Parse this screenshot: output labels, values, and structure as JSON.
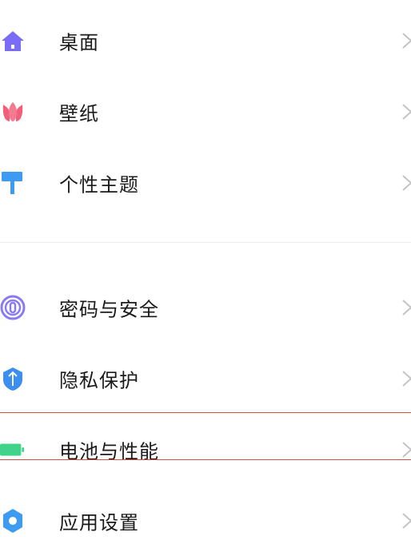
{
  "settings": {
    "group1": [
      {
        "label": "桌面",
        "icon": "home-icon",
        "color": "#7b6cf6"
      },
      {
        "label": "壁纸",
        "icon": "tulip-icon",
        "color": "#f0607a"
      },
      {
        "label": "个性主题",
        "icon": "paint-roller-icon",
        "color": "#3e9bf2"
      }
    ],
    "group2": [
      {
        "label": "密码与安全",
        "icon": "fingerprint-icon",
        "color": "#8a7cf0"
      },
      {
        "label": "隐私保护",
        "icon": "shield-icon",
        "color": "#3b8ff0"
      },
      {
        "label": "电池与性能",
        "icon": "battery-icon",
        "color": "#3fd48a"
      },
      {
        "label": "应用设置",
        "icon": "gear-icon",
        "color": "#3e9bf2"
      }
    ]
  },
  "highlight_color": "#d84b3f"
}
